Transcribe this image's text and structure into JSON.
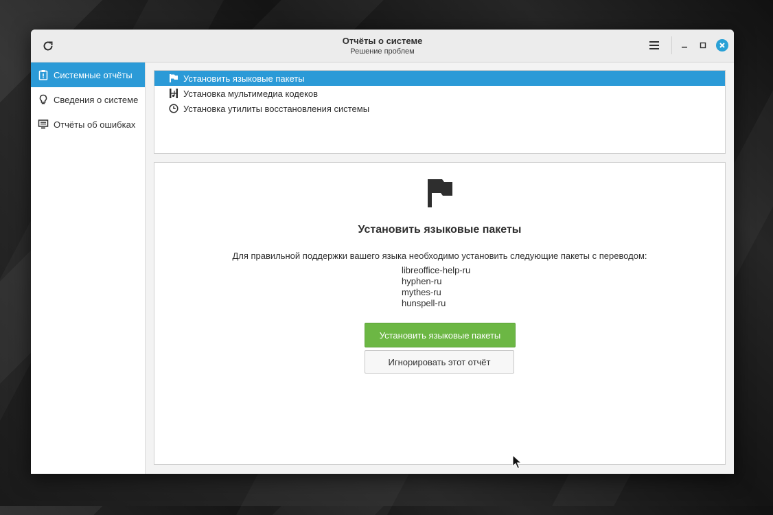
{
  "window": {
    "title": "Отчёты о системе",
    "subtitle": "Решение проблем"
  },
  "titlebar_icons": {
    "refresh": "refresh-icon",
    "menu": "hamburger-menu-icon",
    "minimize": "minimize-icon",
    "maximize": "maximize-icon",
    "close": "close-icon"
  },
  "sidebar": {
    "items": [
      {
        "label": "Системные отчёты",
        "icon": "clipboard-alert-icon",
        "active": true
      },
      {
        "label": "Сведения о системе",
        "icon": "lightbulb-icon",
        "active": false
      },
      {
        "label": "Отчёты об ошибках",
        "icon": "monitor-icon",
        "active": false
      }
    ]
  },
  "reports": {
    "items": [
      {
        "label": "Установить языковые пакеты",
        "icon": "flag-icon",
        "selected": true
      },
      {
        "label": "Установка мультимедиа кодеков",
        "icon": "film-music-icon",
        "selected": false
      },
      {
        "label": "Установка утилиты восстановления системы",
        "icon": "clock-icon",
        "selected": false
      }
    ]
  },
  "detail": {
    "icon": "flag-icon",
    "title": "Установить языковые пакеты",
    "description": "Для правильной поддержки вашего языка необходимо установить следующие пакеты с переводом:",
    "packages": [
      "libreoffice-help-ru",
      "hyphen-ru",
      "mythes-ru",
      "hunspell-ru"
    ],
    "install_button": "Установить языковые пакеты",
    "ignore_button": "Игнорировать этот отчёт"
  },
  "colors": {
    "accent": "#2b9ad7",
    "install_button": "#6cb744",
    "close_button": "#2aa1d6"
  }
}
